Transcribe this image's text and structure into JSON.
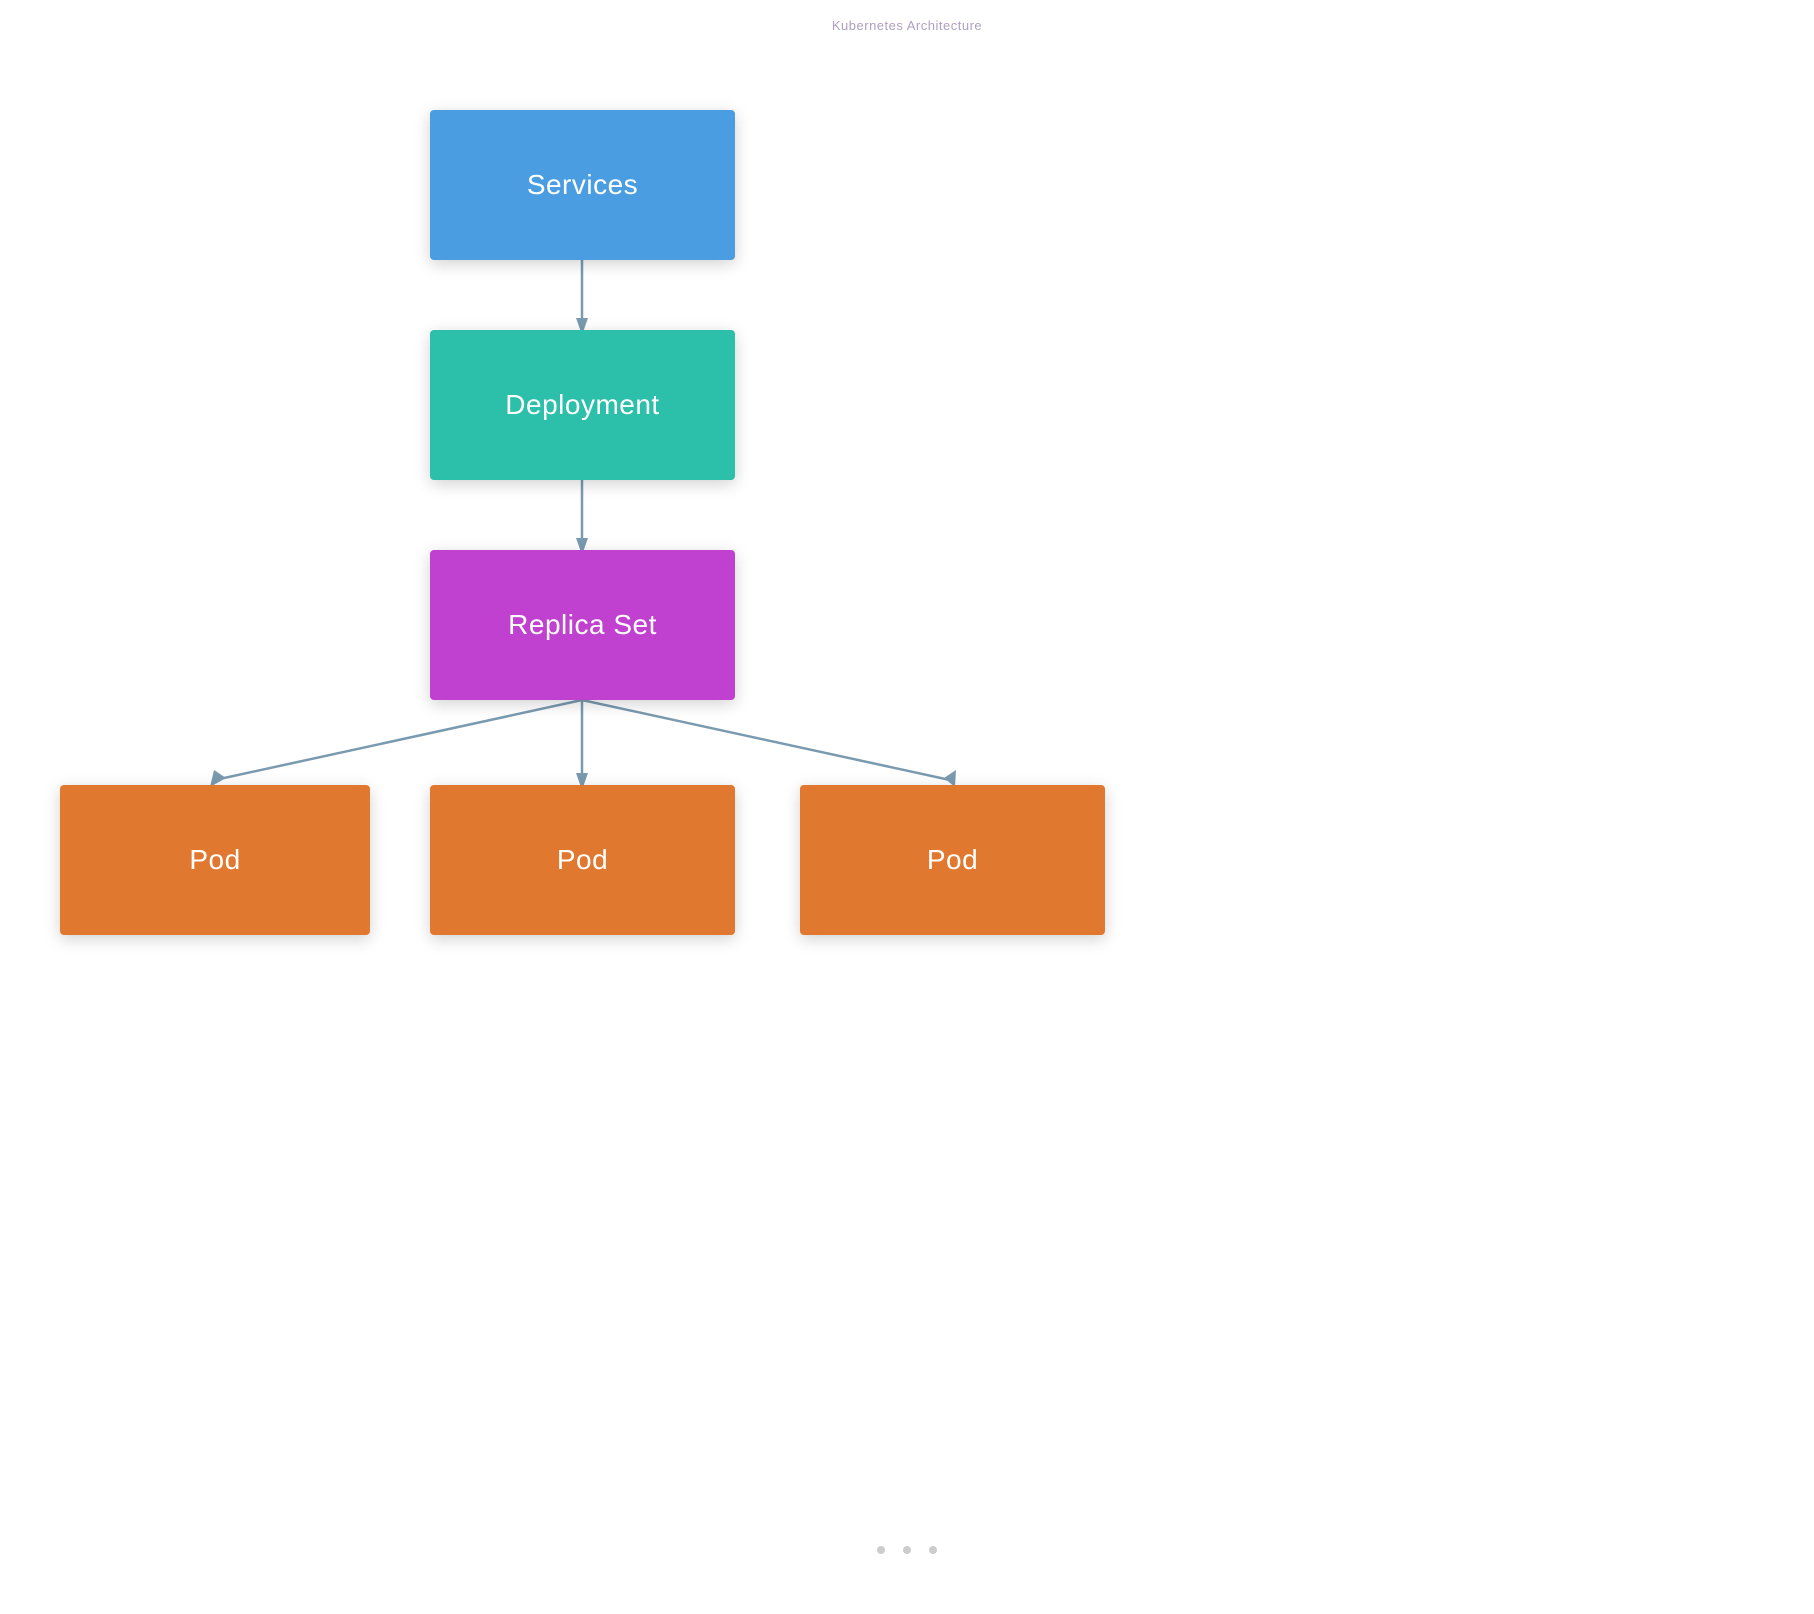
{
  "diagram": {
    "top_label": "Kubernetes Architecture",
    "nodes": {
      "services": {
        "label": "Services",
        "color": "#4a9de0"
      },
      "deployment": {
        "label": "Deployment",
        "color": "#2cbfaa"
      },
      "replicaset": {
        "label": "Replica Set",
        "color": "#c040d0"
      },
      "pod_left": {
        "label": "Pod",
        "color": "#e07830"
      },
      "pod_center": {
        "label": "Pod",
        "color": "#e07830"
      },
      "pod_right": {
        "label": "Pod",
        "color": "#e07830"
      }
    },
    "connector_color": "#7a9ab0",
    "bottom_dots": [
      "dot1",
      "dot2",
      "dot3"
    ]
  }
}
